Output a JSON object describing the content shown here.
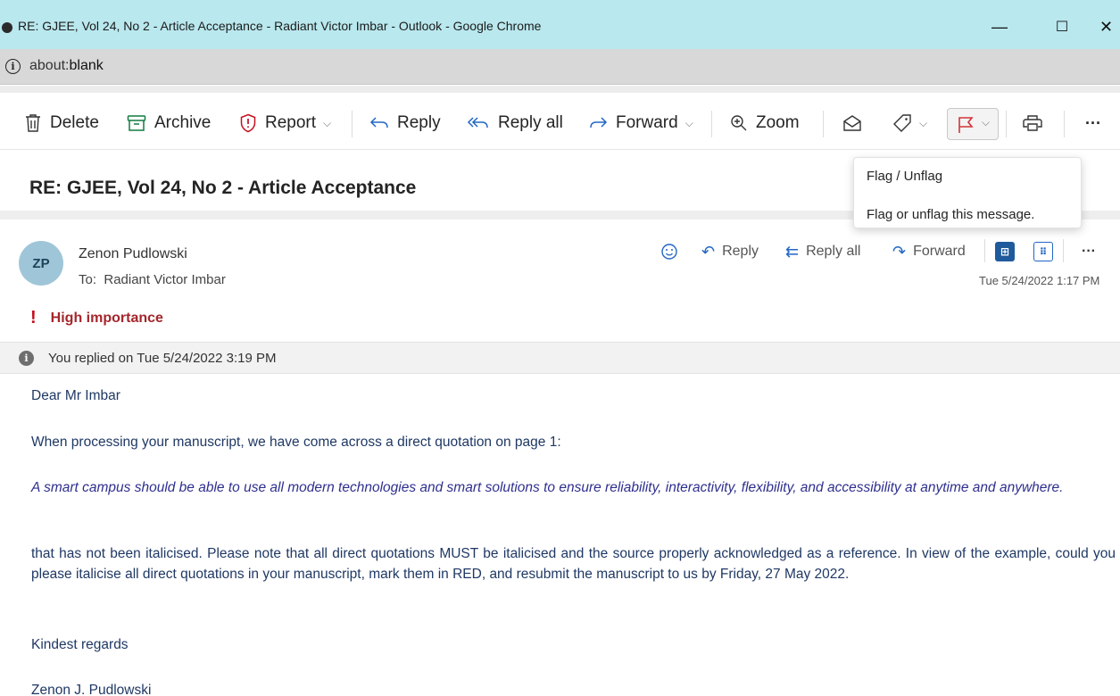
{
  "window": {
    "title": "RE: GJEE, Vol 24, No 2 - Article Acceptance - Radiant Victor Imbar - Outlook - Google Chrome",
    "minimize_glyph": "—",
    "maximize_glyph": "☐",
    "close_glyph": "✕"
  },
  "address": {
    "prefix": "about:",
    "rest": "blank",
    "info_glyph": "i"
  },
  "toolbar": {
    "delete_label": "Delete",
    "archive_label": "Archive",
    "report_label": "Report",
    "reply_label": "Reply",
    "reply_all_label": "Reply all",
    "forward_label": "Forward",
    "zoom_label": "Zoom",
    "more_label": "···"
  },
  "tooltip": {
    "title": "Flag / Unflag",
    "description": "Flag or unflag this message."
  },
  "message": {
    "subject": "RE: GJEE, Vol 24, No 2 - Article Acceptance",
    "avatar_initials": "ZP",
    "sender": "Zenon Pudlowski",
    "to_prefix": "To:",
    "to_name": "Radiant Victor Imbar",
    "actions": {
      "reply": "Reply",
      "reply_all": "Reply all",
      "forward": "Forward",
      "more": "···"
    },
    "timestamp": "Tue 5/24/2022 1:17 PM",
    "importance": "High importance",
    "replied_notice": "You replied on Tue 5/24/2022 3:19 PM"
  },
  "body": {
    "greeting": "Dear Mr Imbar",
    "intro": "When processing your manuscript, we have come across a direct quotation on page 1:",
    "quote": "A smart campus should be able to use all modern technologies and smart solutions to ensure reliability, interactivity, flexibility, and accessibility at anytime and anywhere.",
    "main": "that has not been italicised. Please note that all direct quotations MUST be italicised and the source properly acknowledged as a reference. In view of the example, could you please italicise all direct quotations in your manuscript, mark them in RED, and resubmit the manuscript to us by Friday, 27 May 2022.",
    "regards": "Kindest regards",
    "signature": "Zenon J. Pudlowski"
  },
  "colors": {
    "titlebar": "#b9e8ee",
    "body_text": "#1f3864",
    "quote_text": "#2f2f8f",
    "importance": "#a4262c",
    "flag_red": "#d13438",
    "accent_blue": "#2266c4"
  },
  "icons": {
    "delete": "trash-icon",
    "archive": "archive-icon",
    "report": "report-shield-icon",
    "reply": "reply-arrow-icon",
    "reply_all": "reply-all-icon",
    "forward": "forward-arrow-icon",
    "zoom": "zoom-icon",
    "read": "envelope-open-icon",
    "category": "tag-icon",
    "flag": "flag-icon",
    "print": "print-icon"
  }
}
